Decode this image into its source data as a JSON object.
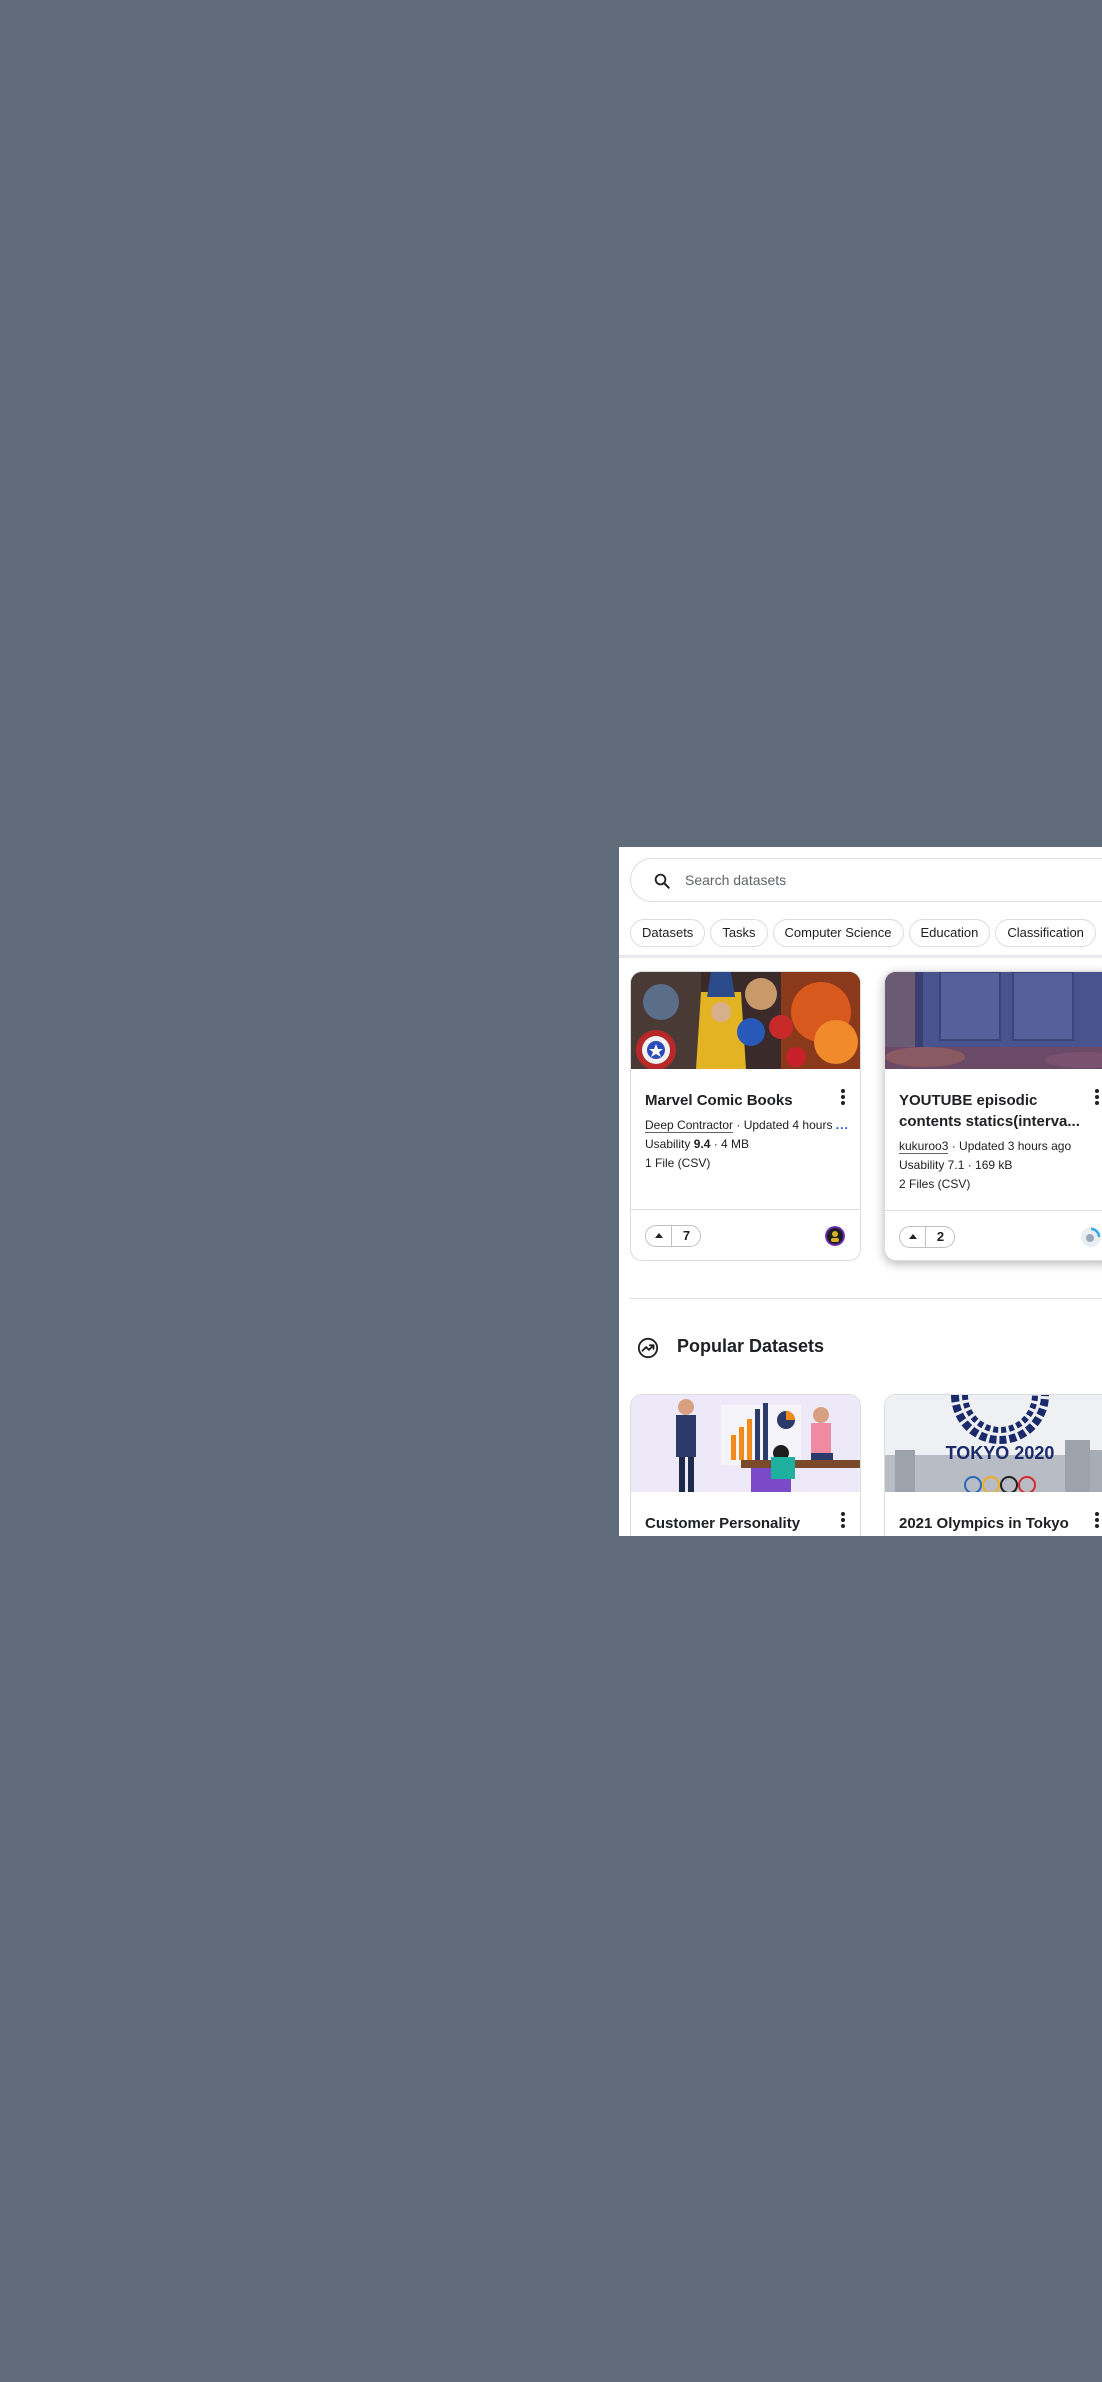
{
  "search": {
    "placeholder": "Search datasets"
  },
  "chips": [
    "Datasets",
    "Tasks",
    "Computer Science",
    "Education",
    "Classification"
  ],
  "trending_cards": [
    {
      "title": "Marvel Comic Books",
      "owner": "Deep Contractor",
      "updated": " · Updated 4 hours ",
      "more": "...",
      "usability_label": "Usability ",
      "usability_value": "9.4",
      "size": " · 4 MB",
      "files": "1 File (CSV)",
      "votes": "7"
    },
    {
      "title": "YOUTUBE episodic contents statics(interva...",
      "owner": "kukuroo3",
      "updated": " · Updated 3 hours ago",
      "usability_text": "Usability 7.1 · 169 kB",
      "files": "2 Files (CSV)",
      "votes": "2"
    }
  ],
  "popular": {
    "title": "Popular Datasets",
    "icon": "trending-icon",
    "cards": [
      {
        "title": "Customer Personality"
      },
      {
        "title": "2021 Olympics in Tokyo",
        "thumb_text": "TOKYO 2020"
      }
    ]
  },
  "colors": {
    "background": "#616c7a",
    "panel": "#ffffff",
    "link_more": "#1a4fd6",
    "border": "#dadce0"
  }
}
